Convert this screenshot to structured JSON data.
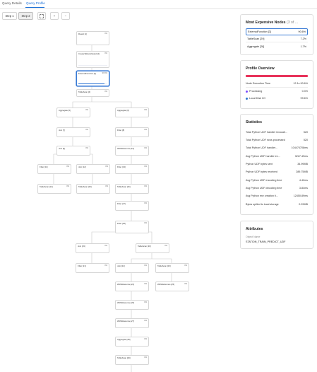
{
  "tabs": [
    {
      "label": "Query Details"
    },
    {
      "label": "Query Profile"
    }
  ],
  "toolbar": {
    "step1": "Step 1",
    "step2": "Step 2",
    "expand_icon": "expand-icon",
    "zoom_in": "+",
    "zoom_out": "−"
  },
  "graph": {
    "nodes": [
      {
        "id": "n1",
        "title": "Result [1]",
        "pct": "0%",
        "desc": "",
        "bar": 0
      },
      {
        "id": "n2",
        "title": "CreateTableAsSelect [2]",
        "pct": "0%",
        "desc": "",
        "bar": 0
      },
      {
        "id": "n3",
        "title": "ExternalFunction [3]",
        "pct": "90.6%",
        "desc": "",
        "bar": 0.906
      },
      {
        "id": "n4",
        "title": "TableScan [4]",
        "pct": "0%",
        "desc": "",
        "bar": 0
      },
      {
        "id": "n5",
        "title": "Aggregate [5]",
        "pct": "0%",
        "desc": "",
        "bar": 0
      },
      {
        "id": "n6",
        "title": "Aggregate [6]",
        "pct": "0%",
        "desc": "",
        "bar": 0
      },
      {
        "id": "n7",
        "title": "Join [7]",
        "pct": "0%",
        "desc": "",
        "bar": 0
      },
      {
        "id": "n8",
        "title": "Filter [8]",
        "pct": "0%",
        "desc": "",
        "bar": 0
      },
      {
        "id": "n9",
        "title": "Join [9]",
        "pct": "0%",
        "desc": "",
        "bar": 0
      },
      {
        "id": "n10",
        "title": "WithReference [10]",
        "pct": "0%",
        "desc": "",
        "bar": 0
      },
      {
        "id": "n11",
        "title": "Filter [11]",
        "pct": "0%",
        "desc": "",
        "bar": 0
      },
      {
        "id": "n12",
        "title": "Join [12]",
        "pct": "0%",
        "desc": "",
        "bar": 0
      },
      {
        "id": "n13",
        "title": "Filter [13]",
        "pct": "0%",
        "desc": "",
        "bar": 0
      },
      {
        "id": "n14",
        "title": "TableScan [14]",
        "pct": "0%",
        "desc": "",
        "bar": 0
      },
      {
        "id": "n15",
        "title": "TableScan [15]",
        "pct": "0%",
        "desc": "",
        "bar": 0
      },
      {
        "id": "n16",
        "title": "TableScan [16]",
        "pct": "0%",
        "desc": "",
        "bar": 0
      },
      {
        "id": "n17",
        "title": "Filter [17]",
        "pct": "0%",
        "desc": "",
        "bar": 0
      },
      {
        "id": "n18",
        "title": "Filter [18]",
        "pct": "0%",
        "desc": "",
        "bar": 0
      },
      {
        "id": "n19",
        "title": "Join [19]",
        "pct": "0%",
        "desc": "",
        "bar": 0
      },
      {
        "id": "n20",
        "title": "TableScan [20]",
        "pct": "0%",
        "desc": "",
        "bar": 0
      },
      {
        "id": "n21",
        "title": "Filter [21]",
        "pct": "0%",
        "desc": "",
        "bar": 0
      },
      {
        "id": "n22",
        "title": "Join [22]",
        "pct": "0%",
        "desc": "",
        "bar": 0
      },
      {
        "id": "n23",
        "title": "TableScan [23]",
        "pct": "0%",
        "desc": "",
        "bar": 0
      },
      {
        "id": "n24",
        "title": "WithReference [24]",
        "pct": "0%",
        "desc": "",
        "bar": 0
      },
      {
        "id": "n25",
        "title": "WithReference [25]",
        "pct": "0%",
        "desc": "",
        "bar": 0
      },
      {
        "id": "n26",
        "title": "WithReference [26]",
        "pct": "0%",
        "desc": "",
        "bar": 0
      },
      {
        "id": "n27",
        "title": "WithReference [27]",
        "pct": "0%",
        "desc": "",
        "bar": 0
      },
      {
        "id": "n28",
        "title": "Aggregate [28]",
        "pct": "0%",
        "desc": "",
        "bar": 0
      },
      {
        "id": "n29",
        "title": "TableScan [29]",
        "pct": "0%",
        "desc": "",
        "bar": 0
      }
    ]
  },
  "expensive": {
    "title": "Most Expensive Nodes",
    "count": "(3 of ...",
    "rows": [
      {
        "label": "ExternalFunction [3]",
        "value": "90.6%",
        "selected": true
      },
      {
        "label": "TableScan [29]",
        "value": "7.2%",
        "selected": false
      },
      {
        "label": "Aggregate [28]",
        "value": "1.7%",
        "selected": false
      }
    ]
  },
  "overview": {
    "title": "Profile Overview",
    "rows": [
      {
        "label": "Node Execution Time",
        "value": "12.1s  90.6%",
        "color": ""
      },
      {
        "label": "Processing",
        "value": "0.3%",
        "color": "#7c4dff"
      },
      {
        "label": "Local Disk I/O",
        "value": "99.6%",
        "color": "#2b78d0"
      }
    ],
    "bar_color": "#e8335b"
  },
  "statistics": {
    "title": "Statistics",
    "rows": [
      {
        "label": "Total Python UDF handler invocati...",
        "value": "520"
      },
      {
        "label": "Total Python UDF rows processed",
        "value": "520"
      },
      {
        "label": "Total Python UDF handler...",
        "value": "104474708ms"
      },
      {
        "label": "Avg Python UDF handler ex...",
        "value": "3227.49ms"
      },
      {
        "label": "Python UDF bytes sent",
        "value": "34.99MB"
      },
      {
        "label": "Python UDF bytes received",
        "value": "289.75MB"
      },
      {
        "label": "Avg Python UDF encoding time",
        "value": "4.42ms"
      },
      {
        "label": "Avg Python UDF decoding time",
        "value": "3.84ms"
      },
      {
        "label": "Avg Python env creation ti...",
        "value": "12450.89ms"
      },
      {
        "label": "Bytes spilled to local storage",
        "value": "0.29MB"
      }
    ]
  },
  "attributes": {
    "title": "Attributes",
    "object_name_label": "Object Name",
    "object_name_value": "STATION_TRAIN_PREDICT_UDF"
  }
}
